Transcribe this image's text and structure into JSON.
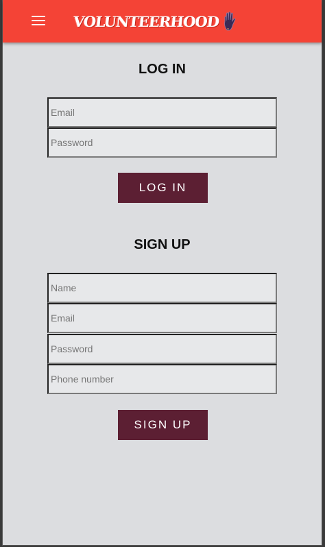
{
  "header": {
    "menu_icon": "hamburger-menu-icon",
    "logo_text": "VOLUNTEERHOOD",
    "logo_icon": "raised-hand-icon",
    "background_color": "#f44336"
  },
  "login": {
    "title": "LOG IN",
    "email_placeholder": "Email",
    "password_placeholder": "Password",
    "button_label": "LOG IN"
  },
  "signup": {
    "title": "SIGN UP",
    "name_placeholder": "Name",
    "email_placeholder": "Email",
    "password_placeholder": "Password",
    "phone_placeholder": "Phone number",
    "button_label": "SIGN UP"
  },
  "colors": {
    "page_background": "#dcdde0",
    "button_background": "#5c1f33"
  }
}
